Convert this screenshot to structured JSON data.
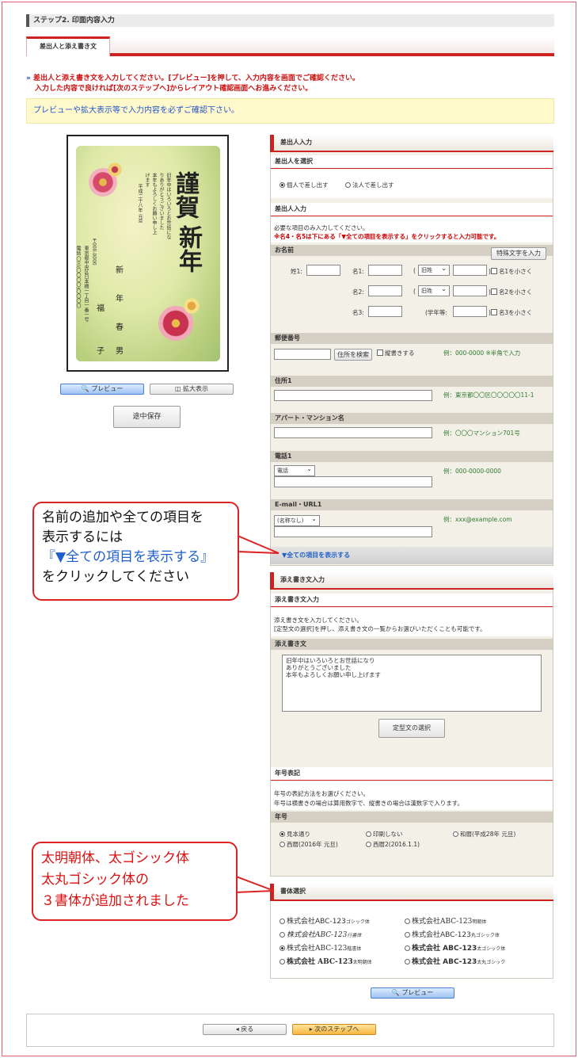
{
  "step_title": "ステップ2. 印面内容入力",
  "tab_label": "差出人と添え書き文",
  "intro": {
    "marker": "»",
    "line1": "差出人と添え書き文を入力してください。[プレビュー]を押して、入力内容を画面でご確認ください。",
    "line2": "入力した内容で良ければ[次のステップへ]からレイアウト確認画面へお進みください。"
  },
  "notice": "プレビューや拡大表示等で入力内容を必ずご確認下さい。",
  "card": {
    "big1": "謹賀",
    "big2": "新年",
    "msg": [
      "旧年中はいろいろとお世話にな",
      "りありがとうございました",
      "本年もよろしくお願い申し上",
      "げます"
    ],
    "date": "平成二十八年 元旦",
    "postal": "〒000-0000",
    "address": "東京都中央区日本橋一丁目一番一号",
    "tel": "電話 〇三(〇〇〇〇)〇〇〇〇",
    "names": [
      "新",
      "年",
      "春",
      "男"
    ],
    "names2": [
      "福",
      "子"
    ]
  },
  "buttons": {
    "preview": "プレビュー",
    "zoom": "拡大表示",
    "save": "途中保存",
    "back": "戻る",
    "next": "次のステップへ",
    "teikei": "定型文の選択",
    "special": "特殊文字を入力",
    "zip_search": "住所を検索"
  },
  "sender": {
    "header": "差出人入力",
    "select_header": "差出人を選択",
    "opt_personal": "個人で差し出す",
    "opt_corp": "法人で差し出す",
    "input_header": "差出人入力",
    "required_note": "必要な項目のみ入力してください。",
    "red_note": "※名4・名5は下にある「▼全ての項目を表示する」をクリックすると入力可能です。",
    "name_label": "お名前",
    "sei1": "姓1:",
    "mei1": "名1:",
    "mei2": "名2:",
    "mei3": "名3:",
    "kyuusei": "旧姓",
    "gakunen": "(学年等:",
    "small1": "名1を小さく",
    "small2": "名2を小さく",
    "small3": "名3を小さく",
    "paren_open": "(",
    "paren_close": ")",
    "zip_label": "郵便番号",
    "tategaki": "縦書きする",
    "zip_example": "例：000-0000 ※半角で入力",
    "addr_label": "住所1",
    "addr_example": "例：東京都〇〇区〇〇〇〇〇11-1",
    "apt_label": "アパート・マンション名",
    "apt_example": "例：〇〇〇マンション701号",
    "phone_label": "電話1",
    "phone_type": "電話",
    "phone_example": "例：000-0000-0000",
    "email_label": "E-mail・URL1",
    "email_type": "(名称なし)",
    "email_example": "例：xxx@example.com",
    "show_all": "▼全ての項目を表示する"
  },
  "soegaki": {
    "header": "添え書き文入力",
    "sub": "添え書き文入力",
    "note1": "添え書き文を入力してください。",
    "note2": "[定型文の選択]を押し、添え書き文の一覧からお選びいただくことも可能です。",
    "label": "添え書き文",
    "text": [
      "旧年中はいろいろとお世話になり",
      "ありがとうございました",
      "本年もよろしくお願い申し上げます"
    ],
    "nengo_header": "年号表記",
    "nengo_note1": "年号の表記方法をお選びください。",
    "nengo_note2": "年号は横書きの場合は算用数字で、縦書きの場合は漢数字で入ります。",
    "nengo_label": "年号",
    "nengo_opts": [
      "見本通り",
      "印刷しない",
      "和暦(平成28年 元旦)",
      "西暦(2016年 元旦)",
      "西暦2(2016.1.1)"
    ]
  },
  "font": {
    "header": "書体選択",
    "opts": [
      {
        "name": "株式会社ABC-123",
        "suffix": "ゴシック体",
        "selected": false
      },
      {
        "name": "株式会社ABC-123",
        "suffix": "明朝体",
        "selected": false
      },
      {
        "name": "株式会社ABC-123",
        "suffix": "行書体",
        "selected": false
      },
      {
        "name": "株式会社ABC-123",
        "suffix": "丸ゴシック体",
        "selected": false
      },
      {
        "name": "株式会社ABC-123",
        "suffix": "楷書体",
        "selected": true
      },
      {
        "name": "株式会社 ABC-123",
        "suffix": "太ゴシック体",
        "selected": false
      },
      {
        "name": "株式会社 ABC-123",
        "suffix": "太明朝体",
        "selected": false
      },
      {
        "name": "株式会社 ABC-123",
        "suffix": "太丸ゴシック",
        "selected": false
      }
    ]
  },
  "callout1": {
    "l1": "名前の追加や全ての項目を",
    "l2": "表示するには",
    "l3": "『▼全ての項目を表示する』",
    "l4": "をクリックしてください"
  },
  "callout2": {
    "l1": "太明朝体、太ゴシック体",
    "l2": "太丸ゴシック体の",
    "l3": "３書体が追加されました"
  },
  "colors": {
    "accent": "#cc2222",
    "notice_bg": "#fff9cc",
    "panel_bg": "#f3f0e8",
    "link": "#1f5fcc"
  }
}
